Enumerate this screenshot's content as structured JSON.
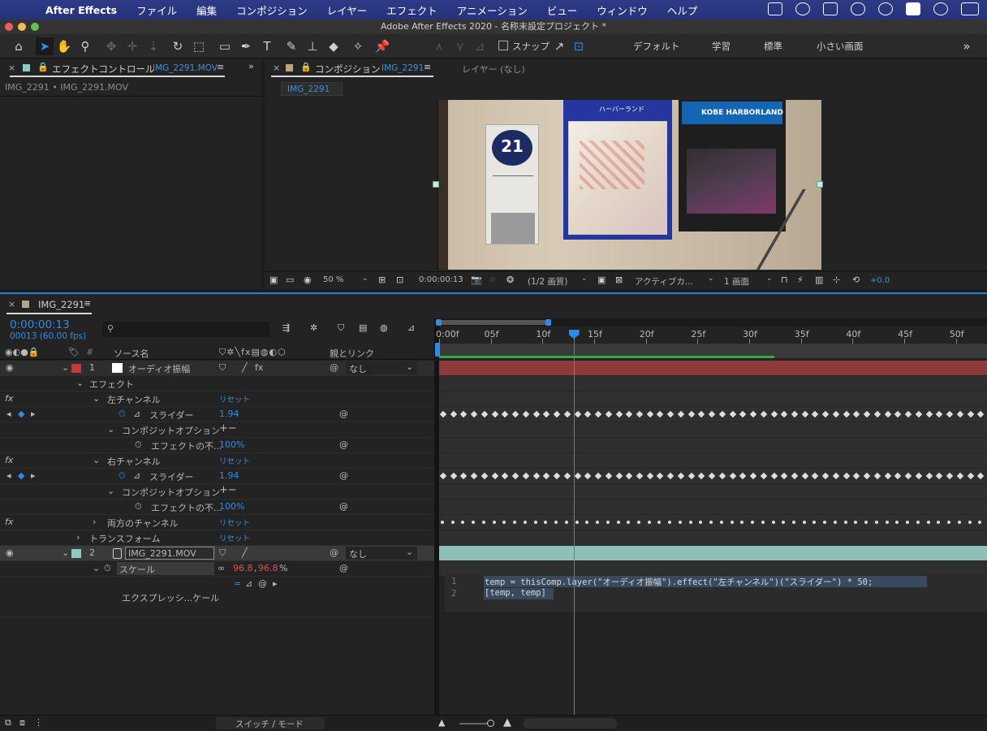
{
  "menubar": {
    "app_name": "After Effects",
    "items": [
      "ファイル",
      "編集",
      "コンポジション",
      "レイヤー",
      "エフェクト",
      "アニメーション",
      "ビュー",
      "ウィンドウ",
      "ヘルプ"
    ]
  },
  "window_title": "Adobe After Effects 2020 - 名称未設定プロジェクト *",
  "toolbar": {
    "snap_label": "スナップ",
    "workspaces": [
      "デフォルト",
      "学習",
      "標準",
      "小さい画面"
    ]
  },
  "effect_panel": {
    "tab_label": "エフェクトコントロール",
    "tab_file": "IMG_2291.MOV",
    "subtitle": "IMG_2291 • IMG_2291.MOV"
  },
  "comp_panel": {
    "tab_label": "コンポジション",
    "tab_comp": "IMG_2291",
    "layer_tab": "レイヤー (なし)",
    "sub_tab": "IMG_2291",
    "zoom": "50 %",
    "timecode": "0:00:00:13",
    "resolution": "(1/2 画質)",
    "camera": "アクティブカ...",
    "views": "1 画面",
    "exposure": "+0.0",
    "video_sign_number": "21",
    "video_sign_harbor": "KOBE HARBORLAND",
    "video_sign_map": "ハーバーランド"
  },
  "timeline": {
    "tab": "IMG_2291",
    "timecode": "0:00:00:13",
    "frame_info": "00013 (60.00 fps)",
    "search_placeholder": "",
    "col_source": "ソース名",
    "col_parent": "親とリンク",
    "switch_mode": "スイッチ / モード",
    "ruler": [
      "0:00f",
      "05f",
      "10f",
      "15f",
      "20f",
      "25f",
      "30f",
      "35f",
      "40f",
      "45f",
      "50f"
    ],
    "playhead_frame": 13,
    "total_frames": 53,
    "layer1": {
      "num": "1",
      "name": "オーディオ振幅",
      "parent": "なし",
      "color": "#c33a3a"
    },
    "effects_label": "エフェクト",
    "left_channel": "左チャンネル",
    "right_channel": "右チャンネル",
    "both_channels": "両方のチャンネル",
    "reset": "リセット",
    "slider": "スライダー",
    "slider_left_value": "1.94",
    "slider_right_value": "1.94",
    "composite_option": "コンポジットオプション",
    "effect_opacity": "エフェクトの不...",
    "opacity_left": "100%",
    "opacity_right": "100%",
    "transform": "トランスフォーム",
    "layer2": {
      "num": "2",
      "name": "IMG_2291.MOV",
      "parent": "なし",
      "color": "#8fc8c0"
    },
    "scale_label": "スケール",
    "scale_value_x": "96.8",
    "scale_sep": ",",
    "scale_value_y": "96.8",
    "scale_unit": "%",
    "expression_label": "エクスプレッシ...ケール",
    "expr_line1": "temp = thisComp.layer(\"オーディオ振幅\").effect(\"左チャンネル\")(\"スライダー\") * 50;",
    "expr_line2": "[temp, temp]",
    "line_no_1": "1",
    "line_no_2": "2"
  },
  "colors": {
    "accent": "#2d8ceb",
    "layer1_bar": "#8c3a3a",
    "layer2_bar": "#8fc0b8",
    "work_area": "#2fa84a"
  }
}
